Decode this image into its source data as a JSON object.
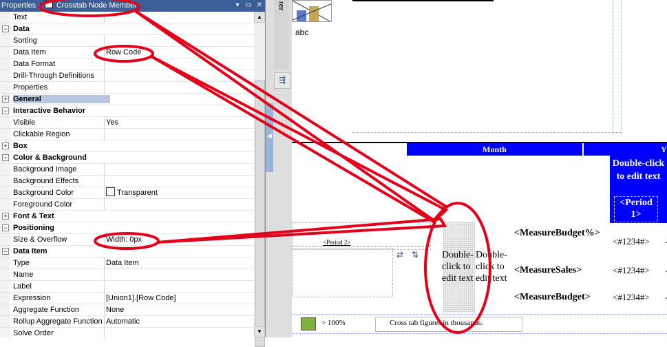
{
  "properties_panel": {
    "title": "Properties -",
    "subtitle": "Crosstab Node Member",
    "pin_glyph": "▾",
    "minimize_glyph": "▭",
    "close_glyph": "✕",
    "rows": [
      {
        "type": "prop",
        "name": "Text",
        "value": ""
      },
      {
        "type": "cat",
        "name": "Data",
        "toggle": "−"
      },
      {
        "type": "prop",
        "name": "Sorting",
        "value": ""
      },
      {
        "type": "prop",
        "name": "Data Item",
        "value": "Row Code"
      },
      {
        "type": "prop",
        "name": "Data Format",
        "value": ""
      },
      {
        "type": "prop",
        "name": "Drill-Through Definitions",
        "value": ""
      },
      {
        "type": "prop",
        "name": "Properties",
        "value": ""
      },
      {
        "type": "cat",
        "name": "General",
        "toggle": "+",
        "selected": true
      },
      {
        "type": "cat",
        "name": "Interactive Behavior",
        "toggle": "−"
      },
      {
        "type": "prop",
        "name": "Visible",
        "value": "Yes"
      },
      {
        "type": "prop",
        "name": "Clickable Region",
        "value": ""
      },
      {
        "type": "cat",
        "name": "Box",
        "toggle": "+"
      },
      {
        "type": "cat",
        "name": "Color & Background",
        "toggle": "−"
      },
      {
        "type": "prop",
        "name": "Background Image",
        "value": ""
      },
      {
        "type": "prop",
        "name": "Background Effects",
        "value": ""
      },
      {
        "type": "prop",
        "name": "Background Color",
        "value": "Transparent",
        "swatch": true
      },
      {
        "type": "prop",
        "name": "Foreground Color",
        "value": ""
      },
      {
        "type": "cat",
        "name": "Font & Text",
        "toggle": "+"
      },
      {
        "type": "cat",
        "name": "Positioning",
        "toggle": "−"
      },
      {
        "type": "prop",
        "name": "Size & Overflow",
        "value": "Width: 0px"
      },
      {
        "type": "cat",
        "name": "Data Item",
        "toggle": "−"
      },
      {
        "type": "prop",
        "name": "Type",
        "value": "Data Item"
      },
      {
        "type": "prop",
        "name": "Name",
        "value": ""
      },
      {
        "type": "prop",
        "name": "Label",
        "value": ""
      },
      {
        "type": "prop",
        "name": "Expression",
        "value": "[Union1].[Row Code]"
      },
      {
        "type": "prop",
        "name": "Aggregate Function",
        "value": "None"
      },
      {
        "type": "prop",
        "name": "Rollup Aggregate Function",
        "value": "Automatic"
      },
      {
        "type": "prop",
        "name": "Solve Order",
        "value": ""
      }
    ],
    "scroll_up": "▲",
    "scroll_down": "▼"
  },
  "toolbox": {
    "tab_label": "rer",
    "tool_icon_glyph": "⇶",
    "splitter_glyph": "◀"
  },
  "canvas": {
    "image_caption": "abc",
    "month_header": "Month",
    "month_header_cut": "Y",
    "double_click_blue": "Double-click to edit text",
    "period1": "<Period 1>",
    "period2": "<Period 2>",
    "double_click_a": "Double-click to edit text",
    "double_click_b": "Double-click to edit text",
    "measures": [
      {
        "label": "<MeasureBudget%>",
        "value": "<#1234#>"
      },
      {
        "label": "<MeasureSales>",
        "value": "<#1234#>"
      },
      {
        "label": "<MeasureBudget>",
        "value": "<#1234#>"
      }
    ],
    "trailing_dash": "-",
    "legend_label": "> 100%",
    "legend_note": "Cross tab figures in thousands.",
    "legend_color": "#7fb23d"
  },
  "colors": {
    "title_bar": "#3d5f97",
    "header_blue": "#0000ff",
    "annotation_red": "#e2001a"
  }
}
